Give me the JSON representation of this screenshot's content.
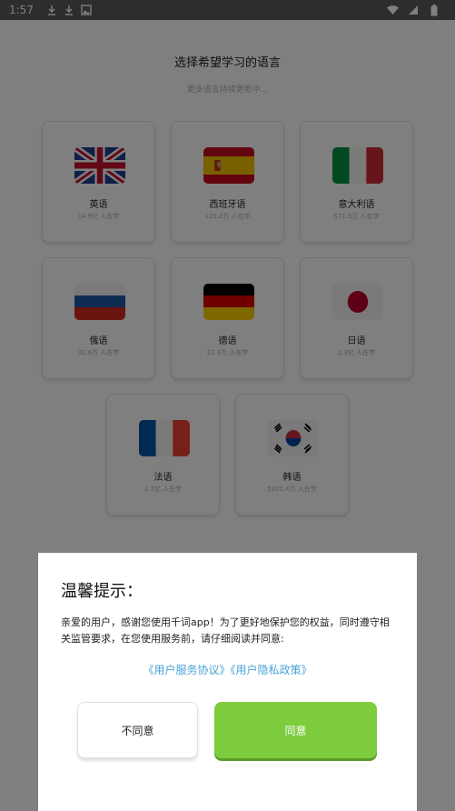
{
  "status_bar": {
    "time": "1:57",
    "left_icons": [
      "download-icon",
      "download-icon",
      "photo-icon"
    ],
    "right_icons": [
      "wifi-icon",
      "signal-icon",
      "battery-icon"
    ]
  },
  "page": {
    "title": "选择希望学习的语言",
    "subtitle": "更多语言持续更新中..."
  },
  "languages": [
    {
      "name": "英语",
      "learners": "14.9亿 人在学",
      "flag": "uk-flag-icon"
    },
    {
      "name": "西班牙语",
      "learners": "120.2万 人在学",
      "flag": "spain-flag-icon"
    },
    {
      "name": "意大利语",
      "learners": "571.5万 人在学",
      "flag": "italy-flag-icon"
    },
    {
      "name": "俄语",
      "learners": "32.6万 人在学",
      "flag": "russia-flag-icon"
    },
    {
      "name": "德语",
      "learners": "22.3万 人在学",
      "flag": "germany-flag-icon"
    },
    {
      "name": "日语",
      "learners": "1.3亿 人在学",
      "flag": "japan-flag-icon"
    },
    {
      "name": "法语",
      "learners": "1.7亿 人在学",
      "flag": "france-flag-icon"
    },
    {
      "name": "韩语",
      "learners": "5201.4万 人在学",
      "flag": "korea-flag-icon"
    }
  ],
  "dialog": {
    "title": "温馨提示：",
    "body": "亲爱的用户，感谢您使用千词app！为了更好地保护您的权益，同时遵守相关监管要求，在您使用服务前，请仔细阅读并同意:",
    "link_service": "《用户服务协议》",
    "link_privacy": "《用户隐私政策》",
    "disagree_label": "不同意",
    "agree_label": "同意"
  },
  "colors": {
    "agree_button": "#7ccc3e",
    "link": "#4aa3d8",
    "overlay": "rgba(0,0,0,0.5)"
  }
}
